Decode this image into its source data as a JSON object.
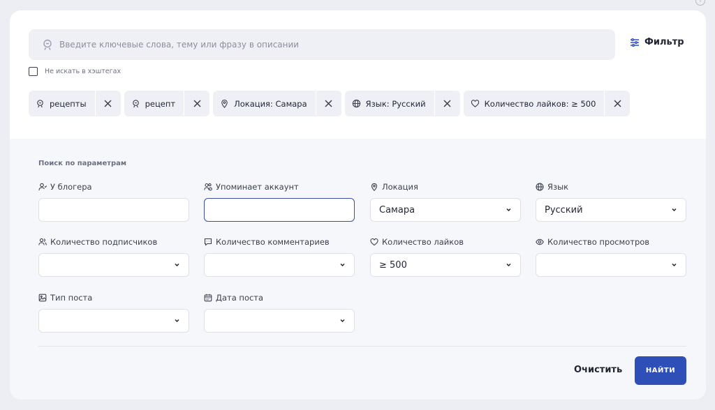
{
  "search": {
    "placeholder": "Введите ключевые слова, тему или фразу в описании",
    "filter_label": "Фильтр",
    "hashtag_checkbox_label": "Не искать в хэштегах",
    "hashtag_checked": false
  },
  "chips": [
    {
      "icon": "keyword-icon",
      "label": "рецепты"
    },
    {
      "icon": "keyword-icon",
      "label": "рецепт"
    },
    {
      "icon": "location-pin-icon",
      "label": "Локация: Самара"
    },
    {
      "icon": "globe-icon",
      "label": "Язык: Русский"
    },
    {
      "icon": "heart-icon",
      "label": "Количество лайков: ≥ 500"
    }
  ],
  "params": {
    "title": "Поиск по параметрам",
    "fields": {
      "blogger": {
        "label": "У блогера",
        "value": ""
      },
      "mentions": {
        "label": "Упоминает аккаунт",
        "value": ""
      },
      "location": {
        "label": "Локация",
        "value": "Самара"
      },
      "language": {
        "label": "Язык",
        "value": "Русский"
      },
      "followers": {
        "label": "Количество подписчиков",
        "value": ""
      },
      "comments": {
        "label": "Количество комментариев",
        "value": ""
      },
      "likes": {
        "label": "Количество лайков",
        "value": "≥ 500"
      },
      "views": {
        "label": "Количество просмотров",
        "value": ""
      },
      "post_type": {
        "label": "Тип поста",
        "value": ""
      },
      "post_date": {
        "label": "Дата поста",
        "value": ""
      }
    }
  },
  "actions": {
    "clear_label": "Очистить",
    "find_label": "НАЙТИ"
  },
  "colors": {
    "primary": "#2e4fb8",
    "focus_border": "#3b4fa8",
    "background": "#eceef3"
  }
}
